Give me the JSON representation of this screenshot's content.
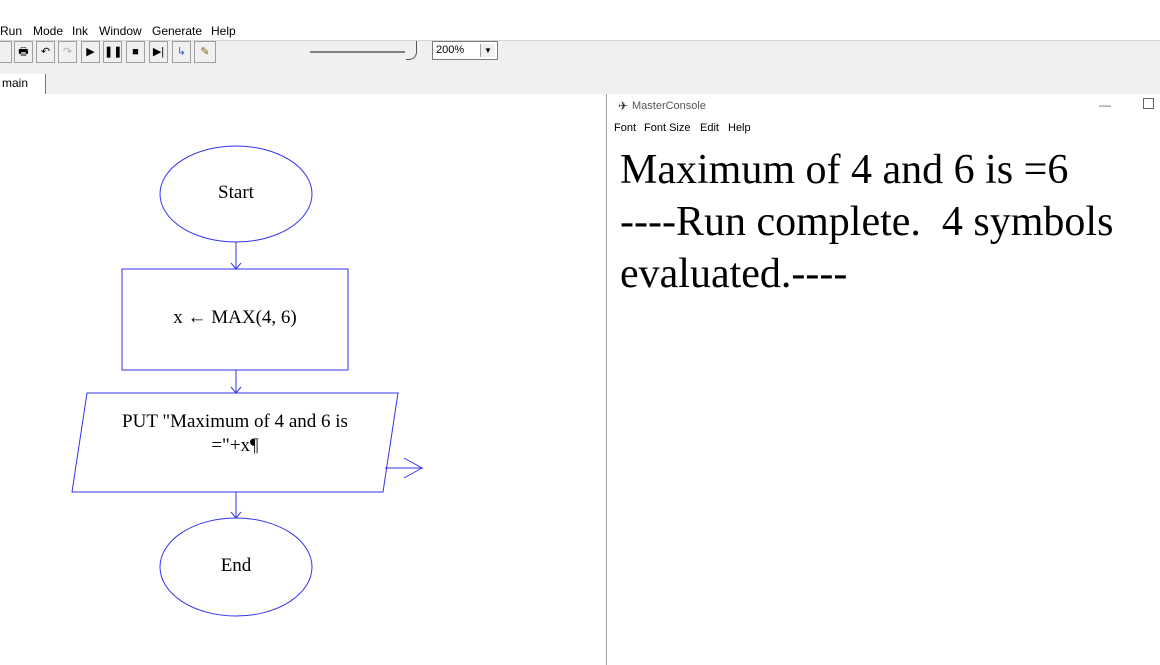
{
  "menu": {
    "items": [
      "Run",
      "Mode",
      "Ink",
      "Window",
      "Generate",
      "Help"
    ]
  },
  "toolbar": {
    "buttons": [
      {
        "icon": "print-icon",
        "glyph": "🖶"
      },
      {
        "icon": "undo-icon",
        "glyph": "↶"
      },
      {
        "icon": "redo-icon",
        "glyph": "↷"
      },
      {
        "icon": "play-icon",
        "glyph": "▶"
      },
      {
        "icon": "pause-icon",
        "glyph": "❚❚"
      },
      {
        "icon": "stop-icon",
        "glyph": "■"
      },
      {
        "icon": "step-icon",
        "glyph": "▶|"
      },
      {
        "icon": "step-into-icon",
        "glyph": "↳"
      },
      {
        "icon": "ink-pen-icon",
        "glyph": "✎"
      }
    ],
    "zoom_value": "200%"
  },
  "tabs": {
    "main_label": "main"
  },
  "flowchart": {
    "start_label": "Start",
    "assignment_label": "x ← MAX(4, 6)",
    "output_line1": "PUT \"Maximum of 4 and 6 is",
    "output_line2": "=\"+x¶",
    "end_label": "End",
    "stroke_color": "#3333ee"
  },
  "console": {
    "title": "MasterConsole",
    "menu": [
      "Font",
      "Font Size",
      "Edit",
      "Help"
    ],
    "output": "Maximum of 4 and 6 is =6\n----Run complete.  4 symbols evaluated.----"
  }
}
